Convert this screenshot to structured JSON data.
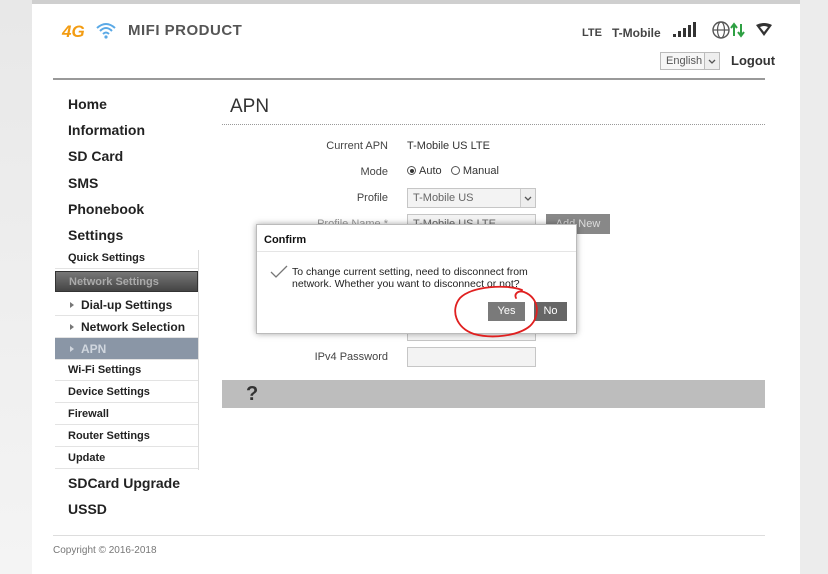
{
  "header": {
    "logo_text": "4G",
    "product": "MIFI PRODUCT",
    "network_type": "LTE",
    "carrier": "T-Mobile",
    "language": "English",
    "logout": "Logout"
  },
  "sidebar": {
    "home": "Home",
    "information": "Information",
    "sd_card": "SD Card",
    "sms": "SMS",
    "phonebook": "Phonebook",
    "settings": "Settings",
    "quick_settings": "Quick Settings",
    "network_settings": "Network Settings",
    "dialup_settings": "Dial-up Settings",
    "network_selection": "Network Selection",
    "apn": "APN",
    "wifi_settings": "Wi-Fi Settings",
    "device_settings": "Device Settings",
    "firewall": "Firewall",
    "router_settings": "Router Settings",
    "update": "Update",
    "sdcard_upgrade": "SDCard Upgrade",
    "ussd": "USSD"
  },
  "main": {
    "title": "APN",
    "current_apn_label": "Current APN",
    "current_apn_value": "T-Mobile US LTE",
    "mode_label": "Mode",
    "mode_auto": "Auto",
    "mode_manual": "Manual",
    "profile_label": "Profile",
    "profile_value": "T-Mobile US",
    "profile_name_label": "Profile Name *",
    "profile_name_value": "T-Mobile US LTE",
    "add_new": "Add New",
    "ipv4_password_label": "IPv4 Password",
    "help": "?"
  },
  "dialog": {
    "title": "Confirm",
    "message": "To change current setting, need to disconnect from network. Whether you want to disconnect or not?",
    "yes": "Yes",
    "no": "No"
  },
  "footer": {
    "copyright": "Copyright © 2016-2018"
  },
  "colors": {
    "annotation": "#e02020",
    "logo_orange": "#f39c12",
    "logo_blue": "#5aa9e6",
    "arrow_green": "#2ea043"
  }
}
